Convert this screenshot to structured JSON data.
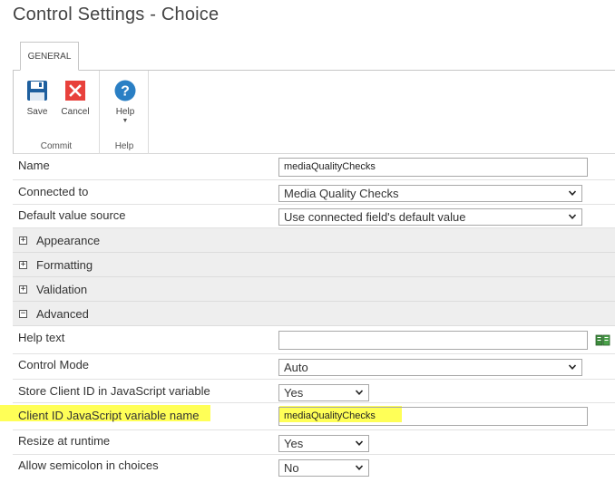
{
  "page": {
    "title": "Control Settings - Choice"
  },
  "ribbon": {
    "tab_general": "GENERAL",
    "save_label": "Save",
    "cancel_label": "Cancel",
    "help_label": "Help",
    "commit_group": "Commit",
    "help_group": "Help",
    "colors": {
      "save": "#1e5f9e",
      "cancel": "#e8413c",
      "help": "#2a7fc4"
    }
  },
  "props": {
    "name": {
      "label": "Name",
      "value": "mediaQualityChecks"
    },
    "connected_to": {
      "label": "Connected to",
      "value": "Media Quality Checks"
    },
    "default_value_source": {
      "label": "Default value source",
      "value": "Use connected field's default value"
    },
    "appearance": {
      "label": "Appearance",
      "expander": "+"
    },
    "formatting": {
      "label": "Formatting",
      "expander": "+"
    },
    "validation": {
      "label": "Validation",
      "expander": "+"
    },
    "advanced": {
      "label": "Advanced",
      "expander": "−"
    },
    "help_text": {
      "label": "Help text",
      "value": ""
    },
    "control_mode": {
      "label": "Control Mode",
      "value": "Auto"
    },
    "store_client_id": {
      "label": "Store Client ID in JavaScript variable",
      "value": "Yes"
    },
    "client_id_var": {
      "label": "Client ID JavaScript variable name",
      "value": "mediaQualityChecks"
    },
    "resize_runtime": {
      "label": "Resize at runtime",
      "value": "Yes"
    },
    "allow_semicolon": {
      "label": "Allow semicolon in choices",
      "value": "No"
    }
  },
  "icons": {
    "save": "save-icon",
    "cancel": "cancel-icon",
    "help": "help-icon",
    "book": "book-icon",
    "caret": "chevron-down-icon"
  },
  "highlight_color": "#ffff3a"
}
